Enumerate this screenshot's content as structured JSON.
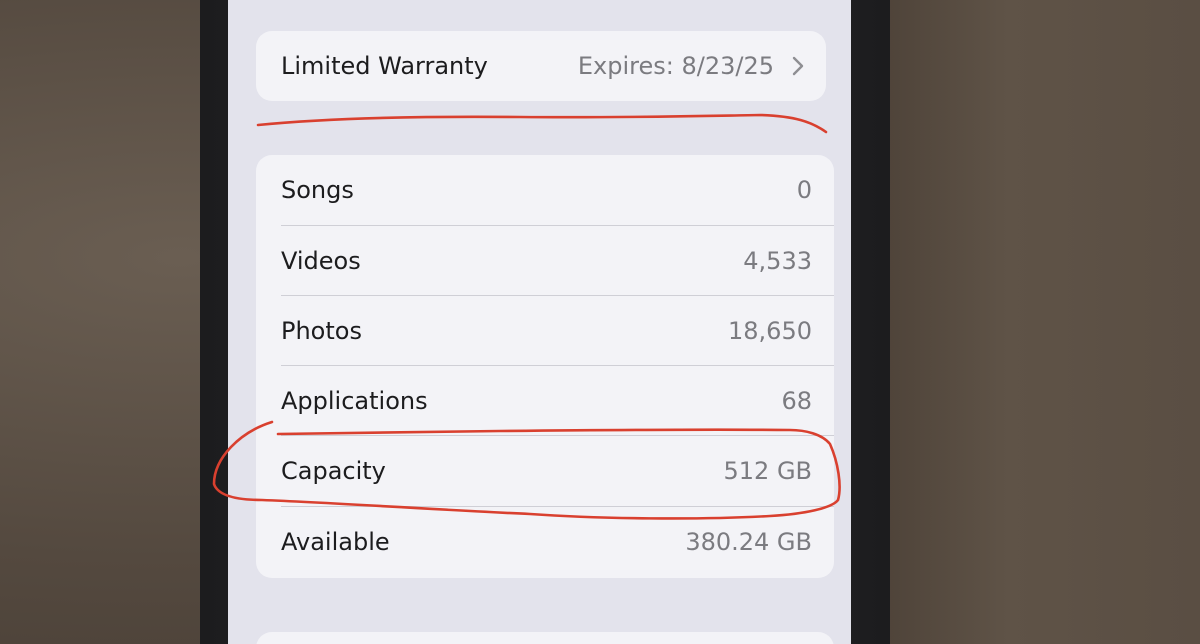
{
  "warranty": {
    "label": "Limited Warranty",
    "value": "Expires: 8/23/25"
  },
  "stats": [
    {
      "label": "Songs",
      "value": "0"
    },
    {
      "label": "Videos",
      "value": "4,533"
    },
    {
      "label": "Photos",
      "value": "18,650"
    },
    {
      "label": "Applications",
      "value": "68"
    },
    {
      "label": "Capacity",
      "value": "512 GB"
    },
    {
      "label": "Available",
      "value": "380.24 GB"
    }
  ],
  "colors": {
    "screen_background": "#e3e3ec",
    "group_background": "#f3f3f7",
    "annotation_ink": "#d9402f"
  },
  "icons": {
    "warranty_chevron": "chevron-right-icon"
  }
}
